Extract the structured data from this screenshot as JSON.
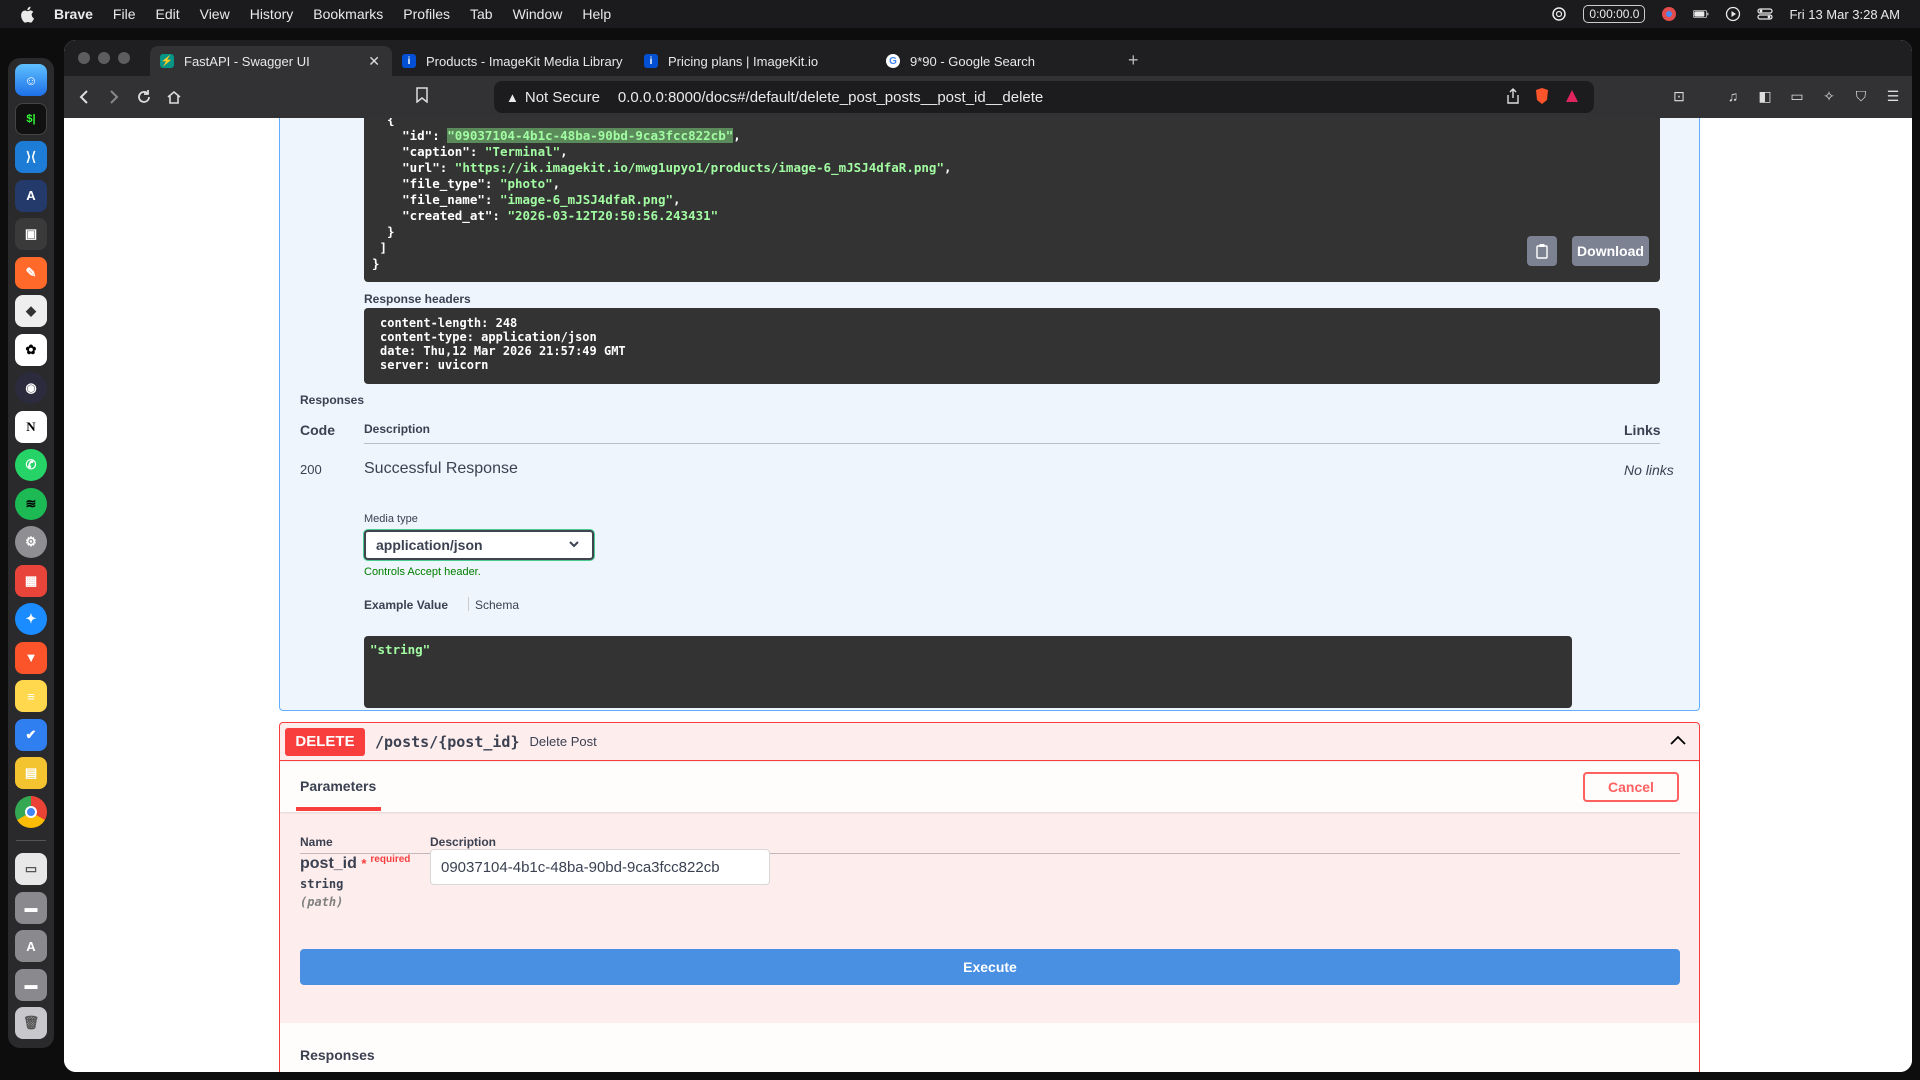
{
  "menubar": {
    "app": "Brave",
    "items": [
      "File",
      "Edit",
      "View",
      "History",
      "Bookmarks",
      "Profiles",
      "Tab",
      "Window",
      "Help"
    ],
    "timer": "0:00:00.0",
    "datetime": "Fri 13 Mar  3:28 AM"
  },
  "dock": {
    "apps": [
      "finder",
      "terminal",
      "vscode",
      "altair",
      "device",
      "pen-tool",
      "sequel-ace",
      "chatgpt",
      "obs",
      "notion",
      "whatsapp",
      "spotify",
      "system-settings",
      "calendar-app",
      "safari",
      "brave",
      "notes",
      "tasks",
      "sheets",
      "chrome",
      "file-manager",
      "folder",
      "folder-apps",
      "folder-2",
      "trash"
    ]
  },
  "browser": {
    "tabs": [
      {
        "title": "FastAPI - Swagger UI",
        "active": true,
        "favicon_color": "#059485"
      },
      {
        "title": "Products - ImageKit Media Library",
        "active": false,
        "favicon_color": "#0450d5"
      },
      {
        "title": "Pricing plans | ImageKit.io",
        "active": false,
        "favicon_color": "#0450d5"
      },
      {
        "title": "9*90 - Google Search",
        "active": false,
        "favicon_color": "#ffffff"
      }
    ],
    "not_secure": "Not Secure",
    "url": "0.0.0.0:8000/docs#/default/delete_post_posts__post_id__delete"
  },
  "get_op": {
    "response_body_lines": [
      {
        "key": "\"id\"",
        "val": "\"09037104-4b1c-48ba-90bd-9ca3fcc822cb\""
      },
      {
        "key": "\"caption\"",
        "val": "\"Terminal\""
      },
      {
        "key": "\"url\"",
        "val": "\"https://ik.imagekit.io/mwg1upyo1/products/image-6_mJSJ4dfaR.png\""
      },
      {
        "key": "\"file_type\"",
        "val": "\"photo\""
      },
      {
        "key": "\"file_name\"",
        "val": "\"image-6_mJSJ4dfaR.png\""
      },
      {
        "key": "\"created_at\"",
        "val": "\"2026-03-12T20:50:56.243431\""
      }
    ],
    "download_label": "Download",
    "response_headers_label": "Response headers",
    "response_headers": "content-length: 248\ncontent-type: application/json\ndate: Thu,12 Mar 2026 21:57:49 GMT\nserver: uvicorn",
    "responses_label": "Responses",
    "col_code": "Code",
    "col_description": "Description",
    "col_links": "Links",
    "code": "200",
    "description": "Successful Response",
    "links": "No links",
    "media_type_label": "Media type",
    "media_type": "application/json",
    "controls_accept": "Controls Accept header.",
    "example_value_tab": "Example Value",
    "schema_tab": "Schema",
    "example_value": "\"string\""
  },
  "delete_op": {
    "method": "DELETE",
    "path": "/posts/{post_id}",
    "summary": "Delete Post",
    "parameters_tab": "Parameters",
    "cancel_label": "Cancel",
    "col_name": "Name",
    "col_description": "Description",
    "param_name": "post_id",
    "required_star": "*",
    "required_text": "required",
    "param_type": "string",
    "param_in": "(path)",
    "param_value": "09037104-4b1c-48ba-90bd-9ca3fcc822cb",
    "execute_label": "Execute",
    "responses_label": "Responses"
  }
}
